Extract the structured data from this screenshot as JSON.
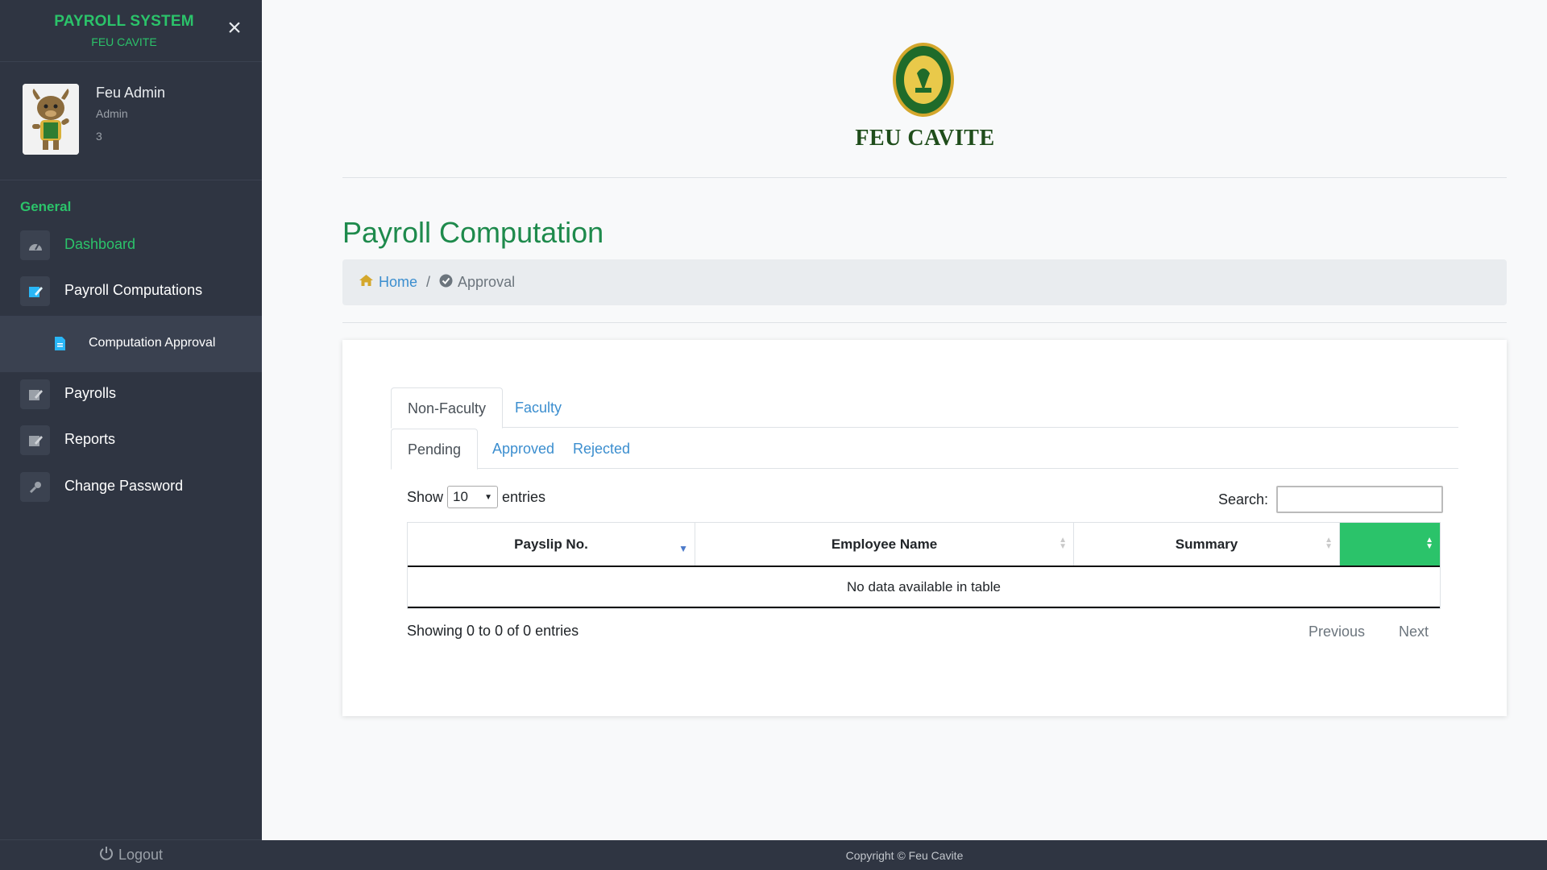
{
  "sidebar": {
    "title": "PAYROLL SYSTEM",
    "subtitle": "FEU CAVITE",
    "close_icon": "×",
    "profile": {
      "name": "Feu Admin",
      "role": "Admin",
      "number": "3"
    },
    "section": "General",
    "items": [
      {
        "label": "Dashboard",
        "icon": "gauge-icon"
      },
      {
        "label": "Payroll Computations",
        "icon": "edit-doc-icon"
      },
      {
        "label": "Computation Approval",
        "icon": "file-icon"
      },
      {
        "label": "Payrolls",
        "icon": "edit-doc-icon"
      },
      {
        "label": "Reports",
        "icon": "edit-doc-icon"
      },
      {
        "label": "Change Password",
        "icon": "key-icon"
      }
    ],
    "logout": "Logout"
  },
  "header": {
    "brand": "FEU CAVITE"
  },
  "page": {
    "title": "Payroll Computation",
    "breadcrumb": {
      "home": "Home",
      "separator": "/",
      "current": "Approval"
    }
  },
  "tabs": {
    "type": [
      {
        "label": "Non-Faculty"
      },
      {
        "label": "Faculty"
      }
    ],
    "status": [
      {
        "label": "Pending"
      },
      {
        "label": "Approved"
      },
      {
        "label": "Rejected"
      }
    ]
  },
  "table": {
    "show_label": "Show",
    "entries_value": "10",
    "entries_label": "entries",
    "search_label": "Search:",
    "search_value": "",
    "columns": [
      "Payslip No.",
      "Employee Name",
      "Summary",
      ""
    ],
    "empty_message": "No data available in table",
    "info": "Showing 0 to 0 of 0 entries",
    "previous": "Previous",
    "next": "Next"
  },
  "footer": {
    "copyright": "Copyright © Feu Cavite"
  },
  "colors": {
    "sidebar_bg": "#2f3542",
    "accent_green": "#2bc36a",
    "link_blue": "#3b8ecf",
    "title_green": "#1e8a4c"
  }
}
